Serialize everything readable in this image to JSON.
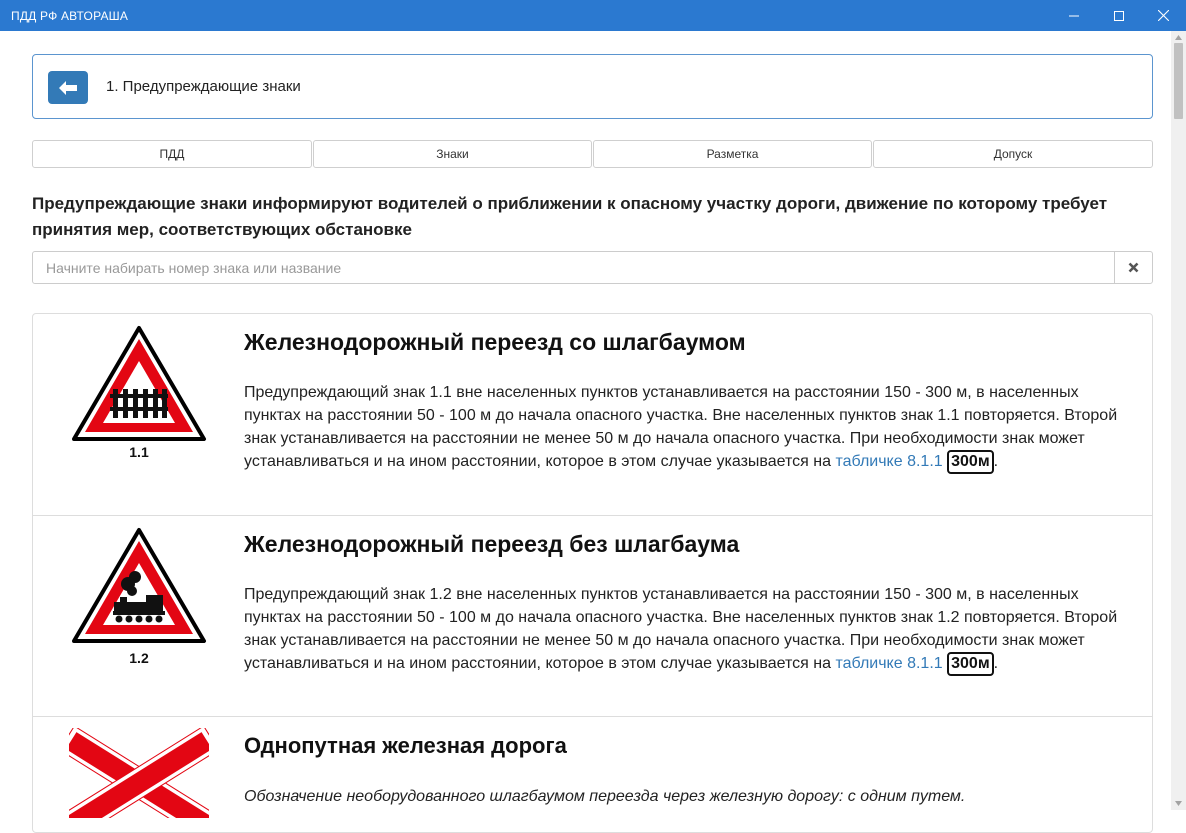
{
  "window": {
    "title": "ПДД РФ АВТОРАША"
  },
  "header": {
    "title": "1. Предупреждающие знаки"
  },
  "tabs": [
    {
      "label": "ПДД"
    },
    {
      "label": "Знаки"
    },
    {
      "label": "Разметка"
    },
    {
      "label": "Допуск"
    }
  ],
  "intro": "Предупреждающие знаки информируют водителей о приближении к опасному участку дороги, движение по которому требует принятия мер, соответствующих обстановке",
  "search": {
    "placeholder": "Начните набирать номер знака или название",
    "value": ""
  },
  "signs": [
    {
      "number": "1.1",
      "title": "Железнодорожный переезд со шлагбаумом",
      "desc_before": "Предупреждающий знак 1.1 вне населенных пунктов устанавливается на расстоянии 150 - 300 м, в населенных пунктах на расстоянии 50 - 100 м до начала опасного участка. Вне населенных пунктов знак 1.1 повторяется. Второй знак устанавливается на расстоянии не менее 50 м до начала опасного участка. При необходимости знак может устанавливаться и на ином расстоянии, которое в этом случае указывается на ",
      "link": "табличке 8.1.1",
      "plate": "300м",
      "desc_after": "."
    },
    {
      "number": "1.2",
      "title": "Железнодорожный переезд без шлагбаума",
      "desc_before": "Предупреждающий знак 1.2 вне населенных пунктов устанавливается на расстоянии 150 - 300 м, в населенных пунктах на расстоянии 50 - 100 м до начала опасного участка. Вне населенных пунктов знак 1.2 повторяется. Второй знак устанавливается на расстоянии не менее 50 м до начала опасного участка. При необходимости знак может устанавливаться и на ином расстоянии, которое в этом случае указывается на ",
      "link": "табличке 8.1.1",
      "plate": "300м",
      "desc_after": "."
    },
    {
      "number": "",
      "title": "Однопутная железная дорога",
      "desc": "Обозначение необорудованного шлагбаумом переезда через железную дорогу: с одним путем."
    }
  ],
  "colors": {
    "titlebar": "#2b79d0",
    "accent": "#337ab7",
    "sign_red": "#e30613"
  }
}
